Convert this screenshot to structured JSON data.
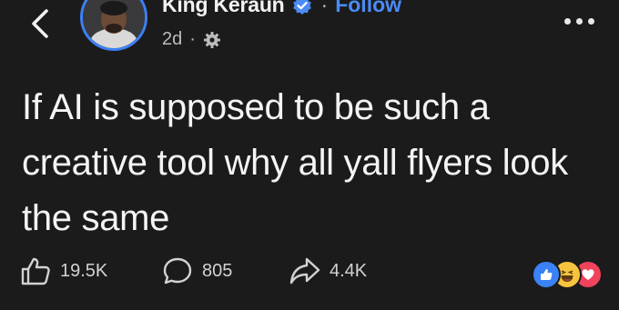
{
  "author": {
    "name": "King Keraun",
    "verified": true,
    "follow_label": "Follow",
    "separator": "·",
    "time": "2d",
    "audience_icon": "gear-icon"
  },
  "post": {
    "text": "If AI is supposed to be such a creative tool why all yall flyers look the same"
  },
  "actions": {
    "like_count": "19.5K",
    "comment_count": "805",
    "share_count": "4.4K"
  },
  "reactions": [
    "like",
    "haha",
    "love"
  ],
  "colors": {
    "background": "#1b1b1c",
    "accent": "#4a8bf5",
    "love": "#f1435b",
    "haha": "#f7c43d"
  }
}
